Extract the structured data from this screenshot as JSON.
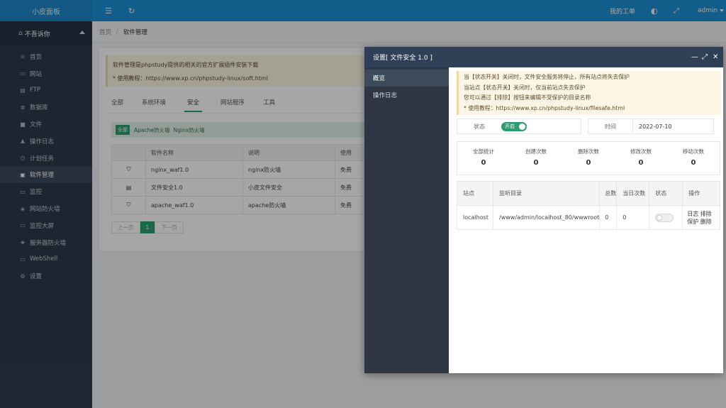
{
  "topbar": {
    "logo": "小皮面板",
    "menu_icon": "☰",
    "refresh_icon": "↻",
    "my_orders": "我的工单",
    "skin_icon": "◐",
    "fullscreen_icon": "⤢",
    "user": "admin"
  },
  "sidebar": {
    "user_name": "不吾诉你",
    "items": [
      {
        "icon": "⌂",
        "label": "首页"
      },
      {
        "icon": "▭",
        "label": "网站"
      },
      {
        "icon": "▤",
        "label": "FTP"
      },
      {
        "icon": "≣",
        "label": "数据库"
      },
      {
        "icon": "■",
        "label": "文件"
      },
      {
        "icon": "▲",
        "label": "操作日志"
      },
      {
        "icon": "◷",
        "label": "计划任务"
      },
      {
        "icon": "▣",
        "label": "软件管理"
      },
      {
        "icon": "▭",
        "label": "监控"
      },
      {
        "icon": "◈",
        "label": "网站防火墙"
      },
      {
        "icon": "▭",
        "label": "监控大屏"
      },
      {
        "icon": "◈",
        "label": "服务器防火墙"
      },
      {
        "icon": "▭",
        "label": "WebShell"
      },
      {
        "icon": "⚙",
        "label": "设置"
      }
    ]
  },
  "breadcrumb": {
    "home": "首页",
    "sep": "/",
    "current": "软件管理"
  },
  "main": {
    "notice_line1": "软件管理是phpstudy提供的相关的官方扩展插件安装下载",
    "notice_line2": "* 使用教程：https://www.xp.cn/phpstudy-linux/soft.html",
    "tabs": [
      "全部",
      "系统环境",
      "安全",
      "网站程序",
      "工具"
    ],
    "filter": {
      "tag": "全部",
      "items": [
        "Apache防火墙",
        "Nginx防火墙"
      ]
    },
    "table": {
      "headers": [
        "",
        "软件名称",
        "说明",
        "使用"
      ],
      "rows": [
        {
          "icon": "⛉",
          "name": "nginx_waf1.0",
          "desc": "nginx防火墙",
          "price": "免费"
        },
        {
          "icon": "▤",
          "name": "文件安全1.0",
          "desc": "小皮文件安全",
          "price": "免费"
        },
        {
          "icon": "⛉",
          "name": "apache_waf1.0",
          "desc": "apache防火墙",
          "price": "免费"
        }
      ]
    },
    "pager": {
      "prev": "上一页",
      "page": "1",
      "next": "下一页"
    }
  },
  "modal": {
    "title": "设置[ 文件安全 1.0 ]",
    "min_icon": "—",
    "max_icon": "⤢",
    "close_icon": "✕",
    "nav": [
      "概览",
      "操作日志"
    ],
    "tips": [
      "当【状态开关】关闭时，文件安全服务将停止，所有站点将失去保护",
      "当站点【状态开关】关闭时，仅当前站点失去保护",
      "您可以通过【排除】按钮来编辑不受保护的目录名称",
      "* 使用教程：https://www.xp.cn/phpstudy-linux/filesafe.html"
    ],
    "status_label": "状态",
    "status_toggle": "开启",
    "time_label": "时间",
    "time_value": "2022-07-10",
    "stats": [
      {
        "label": "全部统计",
        "value": "0"
      },
      {
        "label": "创建次数",
        "value": "0"
      },
      {
        "label": "删除次数",
        "value": "0"
      },
      {
        "label": "修改次数",
        "value": "0"
      },
      {
        "label": "移动次数",
        "value": "0"
      }
    ],
    "site_table": {
      "headers": [
        "站点",
        "监听目录",
        "总数",
        "当日次数",
        "状态",
        "操作"
      ],
      "rows": [
        {
          "site": "localhost",
          "dir": "/www/admin/localhost_80/wwwroot",
          "total": "0",
          "today": "0",
          "actions": [
            "日志",
            "排除",
            "保护",
            "删除"
          ]
        }
      ]
    }
  }
}
